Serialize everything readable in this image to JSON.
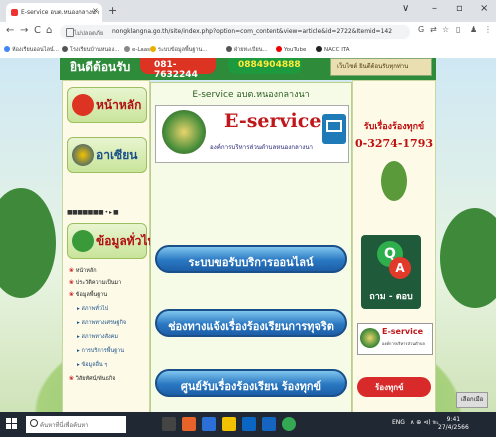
{
  "browser": {
    "tab_title": "E-service อบต.หนองกลางนา",
    "new_tab": "+",
    "tab_close": "×",
    "window_controls": [
      "∨",
      "–",
      "▫",
      "×"
    ],
    "nav": {
      "back": "←",
      "forward": "→",
      "reload": "C",
      "home": "⌂"
    },
    "secure_label": "ไม่ปลอดภัย",
    "url": "nongklangna.go.th/site/index.php?option=com_content&view=article&id=2722&Itemid=142",
    "right_icons": [
      "G",
      "⇄",
      "☆",
      "▯",
      "♟",
      "⋮"
    ],
    "bookmarks": [
      "ห้องเรียนออนไลน์...",
      "โรงเรียนบ้านหนอง...",
      "e-Laas",
      "ระบบข้อมูลพื้นฐาน...",
      "ฝ่ายทะเบียน...",
      "YouTube",
      "NACC ITA"
    ]
  },
  "site": {
    "top_left": "ยินดีต้อนรับ",
    "phone_pill": "081-7632244",
    "green_pill": "0884904888",
    "top_right": "เว็บไซต์ ยินดีต้อนรับทุกท่าน",
    "left_home": "หน้าหลัก",
    "left_asean": "อาเซียน",
    "flags": "■■■■■■■ • ▸ ■",
    "left_general": "ข้อมูลทั่วไป",
    "menu": [
      {
        "label": "หน้าหลัก",
        "sub": false
      },
      {
        "label": "ประวัติความเป็นมา",
        "sub": false
      },
      {
        "label": "ข้อมูลพื้นฐาน",
        "sub": false
      },
      {
        "label": "สภาพทั่วไป",
        "sub": true
      },
      {
        "label": "สภาพทางเศรษฐกิจ",
        "sub": true
      },
      {
        "label": "สภาพทางสังคม",
        "sub": true
      },
      {
        "label": "การบริการพื้นฐาน",
        "sub": true
      },
      {
        "label": "ข้อมูลอื่น ๆ",
        "sub": true
      },
      {
        "label": "วิสัยทัศน์/พันธกิจ",
        "sub": false
      }
    ],
    "center_header": "E-service อบต.หนองกลางนา",
    "banner_title": "E-service",
    "banner_sub": "องค์การบริหารส่วนตำบลหนองกลางนา",
    "btn_online": "ระบบขอรับบริการออนไลน์",
    "btn_corruption": "ช่องทางแจ้งเรื่องร้องเรียนการทุจริต",
    "btn_complaint": "ศูนย์รับเรื่องร้องเรียน ร้องทุกข์",
    "right_header": "รับเรื่องร้องทุกข์",
    "right_phone": "0-3274-1793",
    "qa_q": "Q",
    "qa_a": "A",
    "qa_label": "ถาม - ตอบ",
    "eservice_small": "E-service",
    "eservice_small_sub": "องค์การบริหารส่วนตำบล",
    "right_bottom": "ร้องทุกข์",
    "small_button": "เลือกเมือ"
  },
  "taskbar": {
    "search_placeholder": "ค้นหาที่นี่เพื่อค้นหา",
    "tray": "ENG",
    "tray_icons": "∧ ⊕ ⊲) ℡",
    "time": "9:41",
    "date": "27/4/2566"
  },
  "colors": {
    "accent_red": "#c0181a",
    "accent_green": "#2e8b3a",
    "button_blue": "#2a78c2"
  }
}
